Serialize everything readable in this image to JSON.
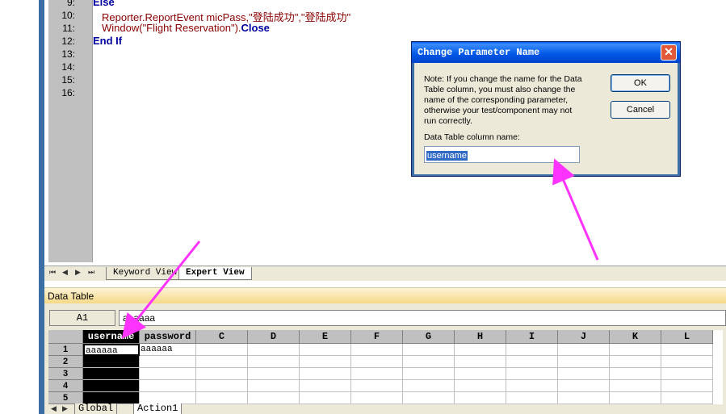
{
  "editor": {
    "lines": [
      {
        "num": "9:",
        "parts": [
          {
            "t": "Else",
            "c": "kw"
          }
        ]
      },
      {
        "num": "10:",
        "parts": [
          {
            "t": "Reporter.ReportEvent micPass,",
            "c": "ob"
          },
          {
            "t": "\"登陆成功\",\"登陆成功\"",
            "c": "st"
          }
        ]
      },
      {
        "num": "11:",
        "parts": [
          {
            "t": "Window(\"Flight Reservation\").",
            "c": "ob"
          },
          {
            "t": "Close",
            "c": "kw"
          }
        ]
      },
      {
        "num": "12:",
        "parts": [
          {
            "t": "End If",
            "c": "kw"
          }
        ]
      },
      {
        "num": "13:",
        "parts": []
      },
      {
        "num": "14:",
        "parts": []
      },
      {
        "num": "15:",
        "parts": []
      },
      {
        "num": "16:",
        "parts": []
      }
    ]
  },
  "view_tabs": {
    "nav": [
      "⏮",
      "◀",
      "▶",
      "⏭"
    ],
    "keyword_view": "Keyword View",
    "expert_view": "Expert View"
  },
  "data_table": {
    "title": "Data Table",
    "cell_ref": "A1",
    "formula_value": "aaaaaa",
    "columns": [
      "username",
      "password",
      "C",
      "D",
      "E",
      "F",
      "G",
      "H",
      "I",
      "J",
      "K",
      "L"
    ],
    "rows": [
      {
        "num": "1",
        "cells": [
          "aaaaaa",
          "aaaaaa"
        ]
      },
      {
        "num": "2",
        "cells": []
      },
      {
        "num": "3",
        "cells": []
      },
      {
        "num": "4",
        "cells": []
      },
      {
        "num": "5",
        "cells": []
      }
    ],
    "sheet_tabs": [
      "Global",
      "Action1"
    ]
  },
  "dialog": {
    "title": "Change Parameter Name",
    "note": "Note: If you change the name for the Data Table column, you must also change the name of the corresponding parameter, otherwise your test/component may not run correctly.",
    "field_label": "Data Table column name:",
    "field_value": "username",
    "ok_label": "OK",
    "cancel_label": "Cancel",
    "close_glyph": "✕"
  },
  "colors": {
    "accent_blue": "#3a6ea5",
    "arrow_magenta": "#ff33ff",
    "title_blue": "#0055e5"
  }
}
